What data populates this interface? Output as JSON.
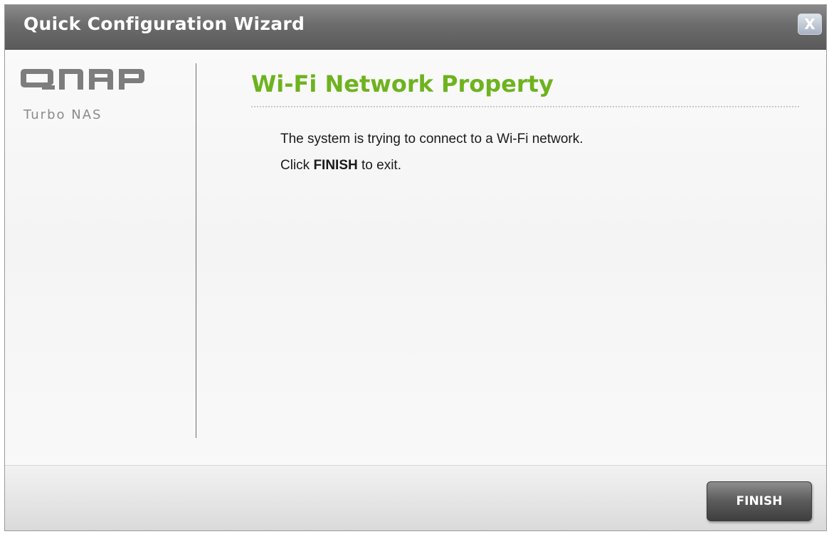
{
  "window": {
    "title": "Quick Configuration Wizard",
    "close_label": "X"
  },
  "logo": {
    "name": "QNAP",
    "subtitle": "Turbo NAS"
  },
  "main": {
    "heading": "Wi-Fi Network Property",
    "message_line1": "The system is trying to connect to a Wi-Fi network.",
    "message_line2_prefix": "Click ",
    "message_line2_bold": "FINISH",
    "message_line2_suffix": " to exit."
  },
  "footer": {
    "finish_label": "FINISH"
  },
  "colors": {
    "accent_green": "#6eb31e",
    "titlebar_gray": "#6c6c6c",
    "button_dark": "#4e4e4e"
  }
}
